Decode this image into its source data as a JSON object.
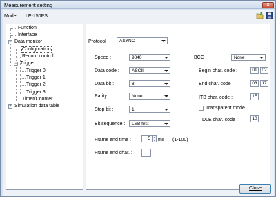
{
  "window": {
    "title": "Measurement setting"
  },
  "model": {
    "label": "Model :",
    "value": "LE-150PS"
  },
  "tree": {
    "function": "Function",
    "interface": "Interface",
    "data_monitor": "Data monitor",
    "configuration": "Configuration",
    "record_control": "Record control",
    "trigger": "Trigger",
    "triggers": [
      "Trigger 0",
      "Trigger 1",
      "Trigger 2",
      "Trigger 3"
    ],
    "timer_counter": "Timer/Counter",
    "simulation": "Simulation data table"
  },
  "form": {
    "protocol": {
      "label": "Protocol :",
      "value": "ASYNC"
    },
    "speed": {
      "label": "Speed :",
      "value": "9840"
    },
    "data_code": {
      "label": "Data code :",
      "value": "ASCII"
    },
    "data_bit": {
      "label": "Data bit :",
      "value": "8"
    },
    "parity": {
      "label": "Parity :",
      "value": "None"
    },
    "stop_bit": {
      "label": "Stop bit :",
      "value": "1"
    },
    "bit_sequence": {
      "label": "Bit sequence :",
      "value": "LSB first"
    },
    "frame_end_time": {
      "label": "Frame end time :",
      "value": "5",
      "unit": "ms",
      "range": "(1-100)"
    },
    "frame_end_char": {
      "label": "Frame end char. :",
      "value": ""
    },
    "bcc": {
      "label": "BCC :",
      "value": "None"
    },
    "begin_char": {
      "label": "Begin char. code :",
      "v1": "01",
      "v2": "02"
    },
    "end_char": {
      "label": "End char. code :",
      "v1": "03",
      "v2": "17"
    },
    "itb_char": {
      "label": "ITB char. code :",
      "value": "1F"
    },
    "transparent": {
      "label": "Transparent mode",
      "checked": false
    },
    "dle_char": {
      "label": "DLE char. code :",
      "value": "10"
    }
  },
  "buttons": {
    "close": "Close"
  },
  "colors": {
    "accent": "#3c7fb1",
    "window_bg": "#d9e4f1"
  }
}
